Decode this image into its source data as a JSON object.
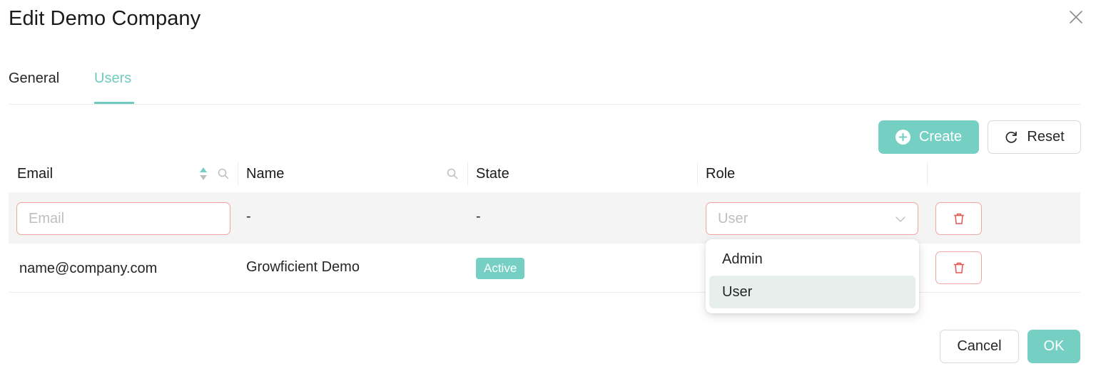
{
  "dialog": {
    "title": "Edit Demo Company"
  },
  "tabs": [
    {
      "label": "General",
      "active": false
    },
    {
      "label": "Users",
      "active": true
    }
  ],
  "toolbar": {
    "create_label": "Create",
    "reset_label": "Reset"
  },
  "table": {
    "columns": [
      "Email",
      "Name",
      "State",
      "Role"
    ],
    "new_row": {
      "email_placeholder": "Email",
      "name": "-",
      "state": "-",
      "role_placeholder": "User"
    },
    "rows": [
      {
        "email": "name@company.com",
        "name": "Growficient Demo",
        "state": "Active"
      }
    ]
  },
  "role_dropdown": {
    "options": [
      "Admin",
      "User"
    ],
    "selected": "User"
  },
  "footer": {
    "cancel_label": "Cancel",
    "ok_label": "OK"
  },
  "colors": {
    "accent": "#75cfc3",
    "danger_border": "#f0a59e",
    "danger_icon": "#e5574d"
  },
  "icons": {
    "close": "close-icon",
    "create": "plus-circle-icon",
    "reset": "reload-icon",
    "sort": "sort-icon",
    "search": "search-icon",
    "chevron": "chevron-down-icon",
    "delete": "trash-icon"
  }
}
